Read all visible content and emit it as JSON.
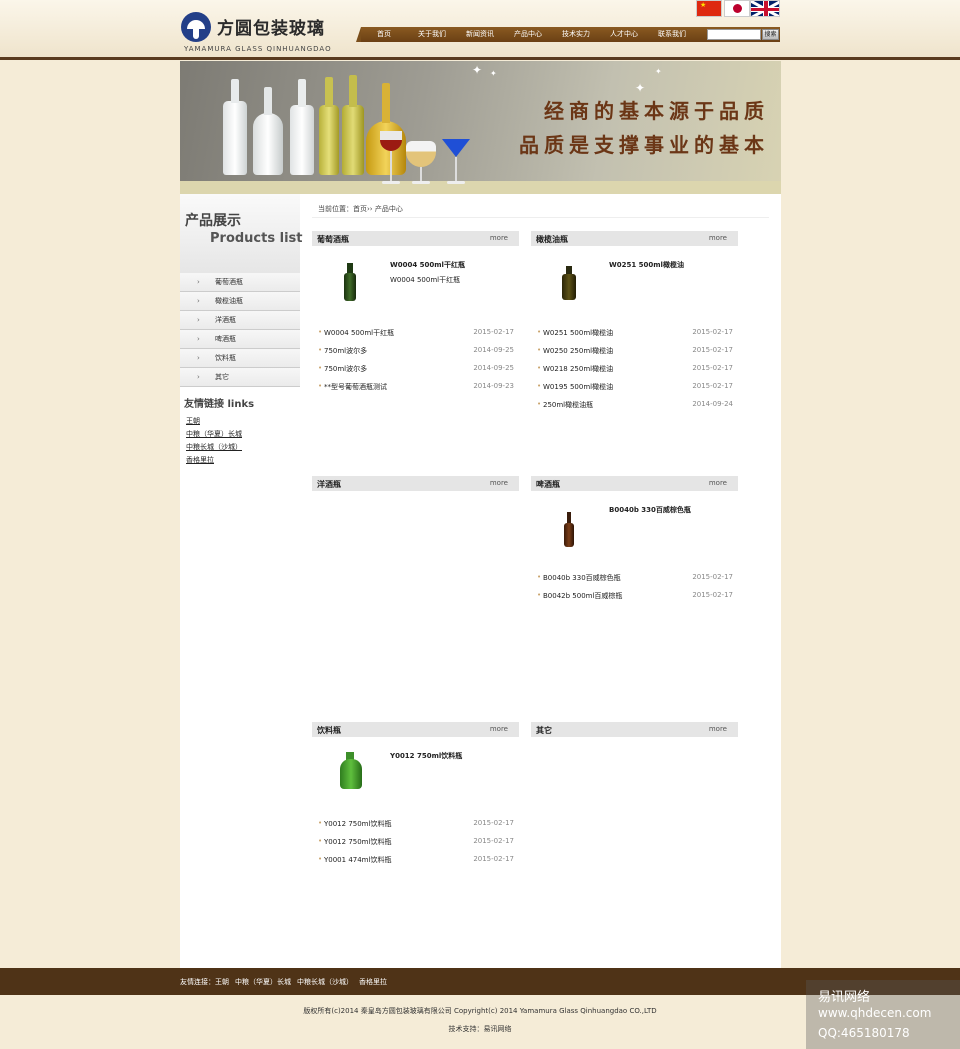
{
  "header": {
    "logo_cn": "方圆包装玻璃",
    "logo_en": "YAMAMURA GLASS QINHUANGDAO",
    "nav": [
      "首页",
      "关于我们",
      "新闻资讯",
      "产品中心",
      "技术实力",
      "人才中心",
      "联系我们"
    ],
    "search_button": "搜索",
    "search_placeholder": "",
    "languages": [
      "flag-cn-icon",
      "flag-jp-icon",
      "flag-uk-icon"
    ]
  },
  "banner": {
    "line1": "经商的基本源于品质",
    "line2": "品质是支撑事业的基本"
  },
  "sidebar": {
    "title_cn": "产品展示",
    "title_en": "Products list",
    "categories": [
      "葡萄酒瓶",
      "橄榄油瓶",
      "洋酒瓶",
      "啤酒瓶",
      "饮料瓶",
      "其它"
    ],
    "links_title": "友情链接  links",
    "links": [
      "王朝",
      "中粮（华夏）长城",
      "中粮长城（沙城）",
      "香格里拉"
    ]
  },
  "breadcrumb": {
    "label": "当前位置：",
    "path": "首页›› 产品中心"
  },
  "more_label": "more",
  "panels": [
    {
      "title": "葡萄酒瓶",
      "featured_title": "W0004 500ml干红瓶",
      "featured_desc": "W0004 500ml干红瓶",
      "items": [
        {
          "name": "W0004 500ml干红瓶",
          "date": "2015-02-17"
        },
        {
          "name": "750ml波尔多",
          "date": "2014-09-25"
        },
        {
          "name": "750ml波尔多",
          "date": "2014-09-25"
        },
        {
          "name": "**型号葡萄酒瓶测试",
          "date": "2014-09-23"
        }
      ]
    },
    {
      "title": "橄榄油瓶",
      "featured_title": "W0251 500ml橄榄油",
      "featured_desc": "",
      "items": [
        {
          "name": "W0251 500ml橄榄油",
          "date": "2015-02-17"
        },
        {
          "name": "W0250 250ml橄榄油",
          "date": "2015-02-17"
        },
        {
          "name": "W0218 250ml橄榄油",
          "date": "2015-02-17"
        },
        {
          "name": "W0195 500ml橄榄油",
          "date": "2015-02-17"
        },
        {
          "name": "250ml橄榄油瓶",
          "date": "2014-09-24"
        }
      ]
    },
    {
      "title": "洋酒瓶",
      "featured_title": "",
      "featured_desc": "",
      "items": []
    },
    {
      "title": "啤酒瓶",
      "featured_title": "B0040b 330百威棕色瓶",
      "featured_desc": "",
      "items": [
        {
          "name": "B0040b 330百威棕色瓶",
          "date": "2015-02-17"
        },
        {
          "name": "B0042b 500ml百威棕瓶",
          "date": "2015-02-17"
        }
      ]
    },
    {
      "title": "饮料瓶",
      "featured_title": "Y0012 750ml饮料瓶",
      "featured_desc": "",
      "items": [
        {
          "name": "Y0012 750ml饮料瓶",
          "date": "2015-02-17"
        },
        {
          "name": "Y0012 750ml饮料瓶",
          "date": "2015-02-17"
        },
        {
          "name": "Y0001 474ml饮料瓶",
          "date": "2015-02-17"
        }
      ]
    },
    {
      "title": "其它",
      "featured_title": "",
      "featured_desc": "",
      "items": []
    }
  ],
  "footer": {
    "links_label": "友情连接：",
    "links": [
      "王朝",
      "中粮（华夏）长城",
      "中粮长城（沙城）",
      "香格里拉"
    ],
    "copyright": "版权所有(c)2014 秦皇岛方圆包装玻璃有限公司  Copyright(c) 2014 Yamamura Glass Qinhuangdao CO.,LTD",
    "support": "技术支持：易讯网络"
  },
  "watermark": {
    "line1": "易讯网络",
    "line2": "www.qhdecen.com",
    "line3": "QQ:465180178"
  },
  "colors": {
    "page_bg": "#f5ecd7",
    "nav_bg": "#7a4e1b",
    "footer_bg": "#4f3317",
    "slogan": "#6b3616"
  }
}
